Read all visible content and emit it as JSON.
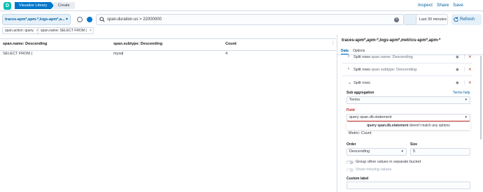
{
  "header": {
    "breadcrumb_1": "Visualize Library",
    "breadcrumb_2": "Create",
    "inspect": "Inspect",
    "share": "Share",
    "save": "Save"
  },
  "querybar": {
    "index_pattern": "traces-apm*,apm-*,logs-apm*,a...",
    "query": "span.duration.us > 22000000",
    "time_range": "Last 30 minutes",
    "refresh": "Refresh"
  },
  "filters": [
    "span.action: query",
    "span.name: SELECT FROM ("
  ],
  "table": {
    "columns": [
      "span.name: Descending",
      "span.subtype: Descending",
      "Count"
    ],
    "rows": [
      [
        "SELECT FROM (",
        "mysql",
        "4"
      ]
    ]
  },
  "sidebar": {
    "title": "traces-apm*,apm-*,logs-apm*,metrics-apm*,apm-*",
    "tabs": [
      "Data",
      "Options"
    ],
    "buckets": [
      {
        "title": "Split rows",
        "detail": "span.name: Descending"
      },
      {
        "title": "Split rows",
        "detail": "span.subtype: Descending"
      },
      {
        "title": "Split rows",
        "detail": ""
      }
    ],
    "sub_aggregation_label": "Sub aggregation",
    "terms_help": "Terms help",
    "sub_aggregation_value": "Terms",
    "field_label": "Field",
    "field_value": "query span.db.statement",
    "error_field": "query span.db.statement",
    "error_rest": "doesn't match any options",
    "metric_label": "Metric: Count",
    "order_label": "Order",
    "order_value": "Descending",
    "size_label": "Size",
    "size_value": "5",
    "toggle_group": "Group other values in separate bucket",
    "toggle_missing": "Show missing values",
    "custom_label": "Custom label"
  },
  "colors": {
    "primary": "#0077cc",
    "error": "#bd271e",
    "teal": "#00bfb3"
  }
}
